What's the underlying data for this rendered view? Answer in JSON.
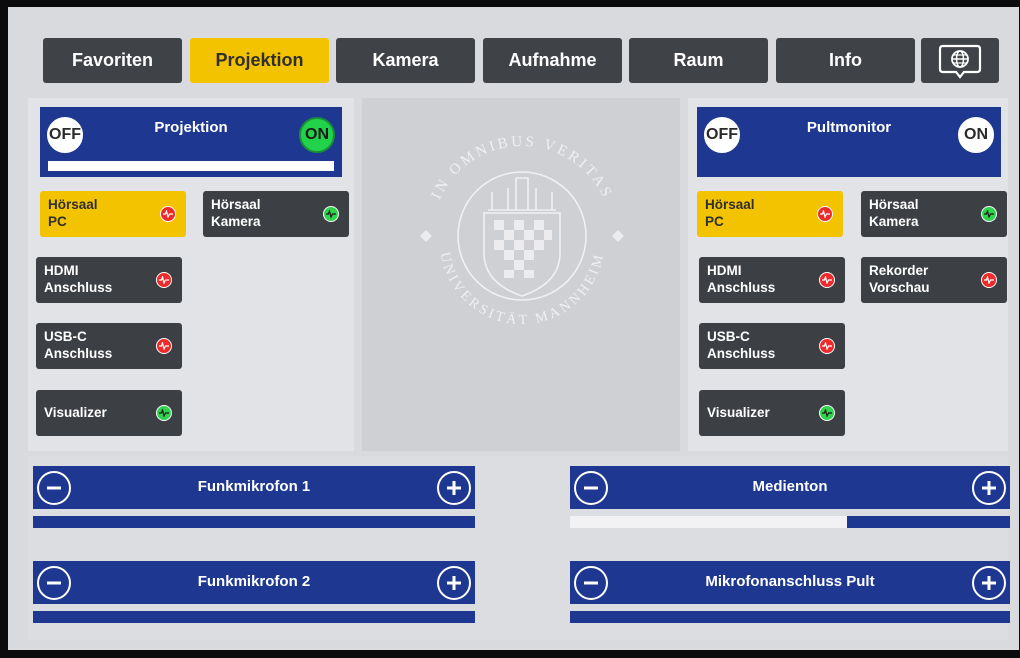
{
  "nav": {
    "tabs": [
      {
        "label": "Favoriten",
        "active": false
      },
      {
        "label": "Projektion",
        "active": true
      },
      {
        "label": "Kamera",
        "active": false
      },
      {
        "label": "Aufnahme",
        "active": false
      },
      {
        "label": "Raum",
        "active": false
      },
      {
        "label": "Info",
        "active": false
      }
    ],
    "language_icon": "globe-speech-bubble-icon"
  },
  "left_display": {
    "title": "Projektion",
    "off_label": "OFF",
    "on_label": "ON",
    "power_state": "on",
    "sources": [
      {
        "label": "Hörsaal\nPC",
        "selected": true,
        "signal": "red"
      },
      {
        "label": "Hörsaal\nKamera",
        "selected": false,
        "signal": "green"
      },
      {
        "label": "HDMI\nAnschluss",
        "selected": false,
        "signal": "red"
      },
      {
        "label": "USB-C\nAnschluss",
        "selected": false,
        "signal": "red"
      },
      {
        "label": "Visualizer",
        "selected": false,
        "signal": "green"
      }
    ]
  },
  "right_display": {
    "title": "Pultmonitor",
    "off_label": "OFF",
    "on_label": "ON",
    "power_state": "none",
    "sources": [
      {
        "label": "Hörsaal\nPC",
        "selected": true,
        "signal": "red"
      },
      {
        "label": "Hörsaal\nKamera",
        "selected": false,
        "signal": "green"
      },
      {
        "label": "HDMI\nAnschluss",
        "selected": false,
        "signal": "red"
      },
      {
        "label": "Rekorder\nVorschau",
        "selected": false,
        "signal": "red"
      },
      {
        "label": "USB-C\nAnschluss",
        "selected": false,
        "signal": "red"
      },
      {
        "label": "Visualizer",
        "selected": false,
        "signal": "green"
      }
    ]
  },
  "preview": {
    "watermark_text": "IN OMNIBUS VERITAS · UNIVERSITÄT MANNHEIM"
  },
  "audio": [
    {
      "label": "Funkmikrofon 1",
      "level": 0.0
    },
    {
      "label": "Medienton",
      "level": 0.63
    },
    {
      "label": "Funkmikrofon 2",
      "level": 0.0
    },
    {
      "label": "Mikrofonanschluss Pult",
      "level": 0.0
    }
  ],
  "colors": {
    "accent_yellow": "#f4c300",
    "panel_blue": "#1e3891",
    "signal_red": "#ee2b2b",
    "signal_green": "#2fd34e",
    "button_dark": "#3c3f44"
  }
}
